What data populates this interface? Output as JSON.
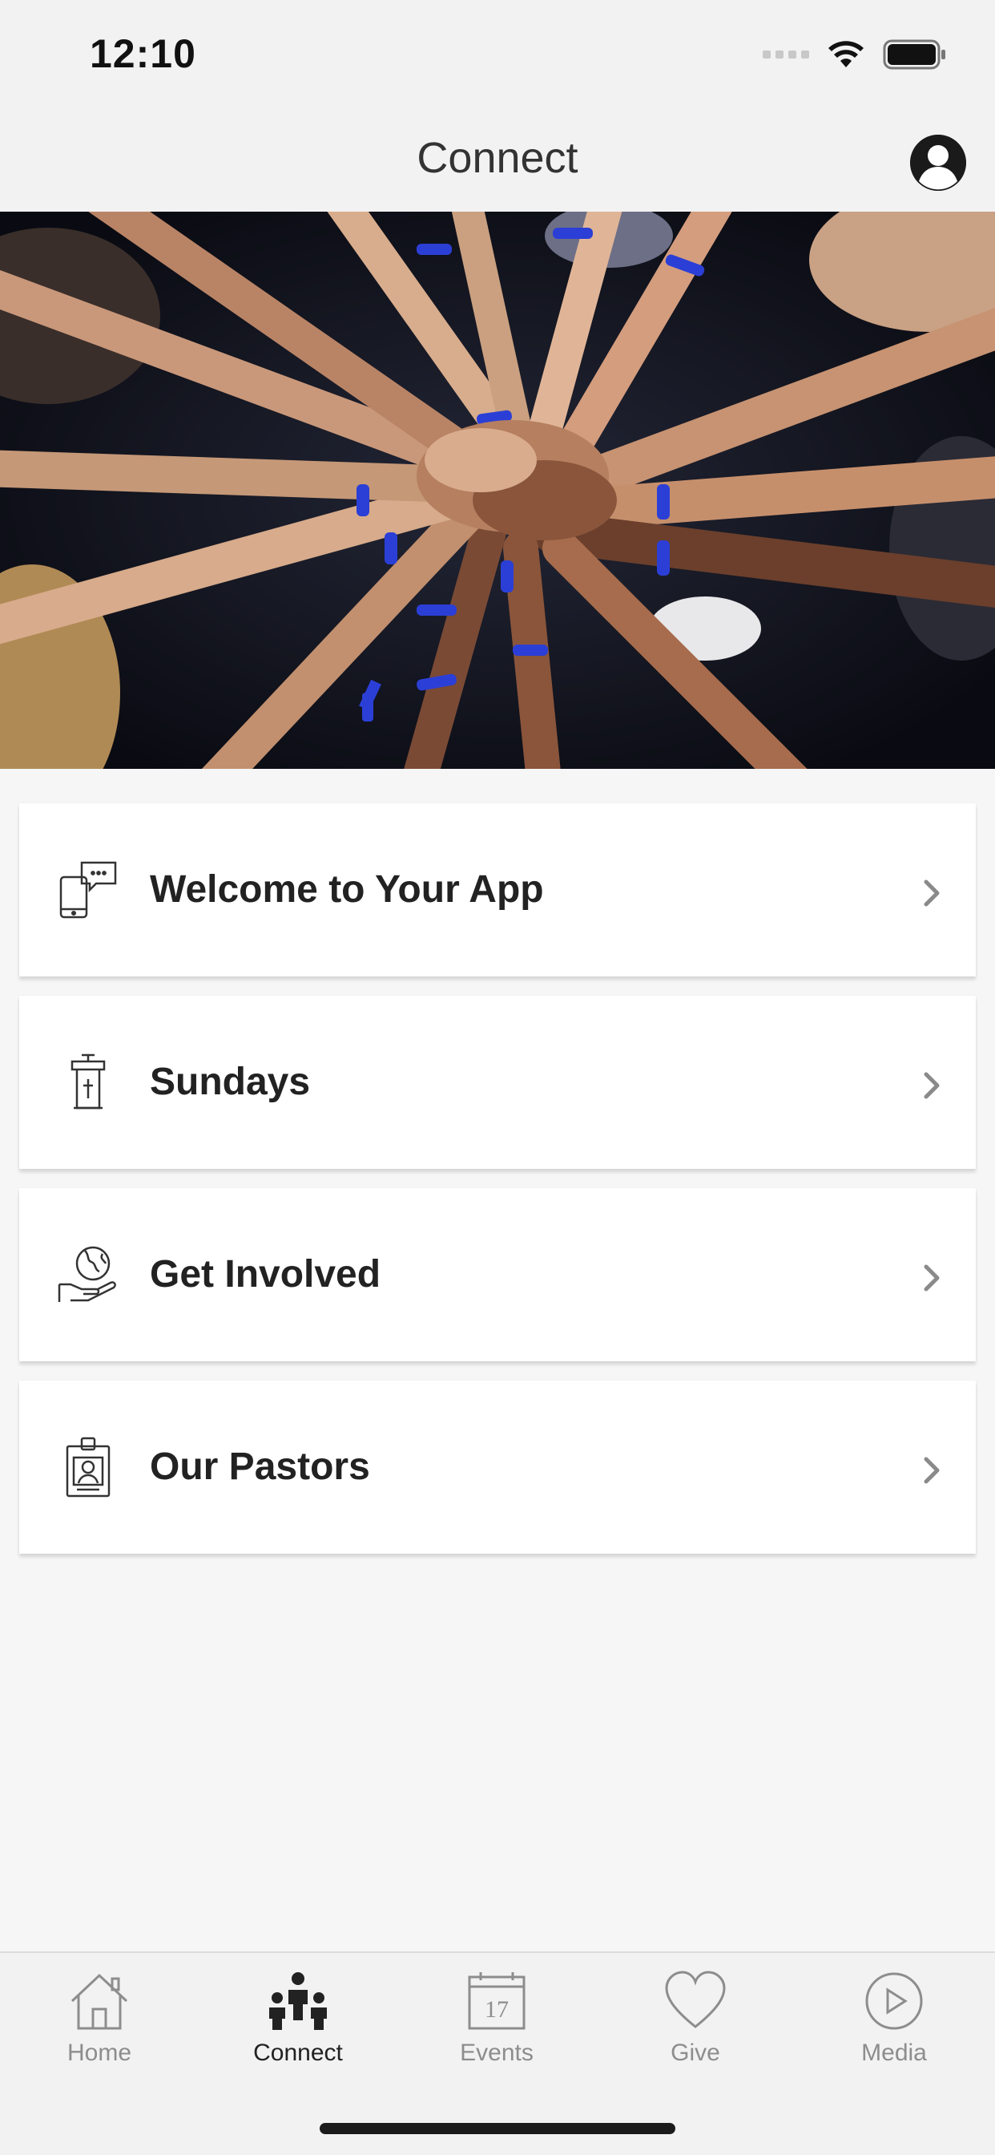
{
  "status_bar": {
    "time": "12:10"
  },
  "header": {
    "title": "Connect",
    "profile_icon": "user-circle-icon"
  },
  "hero": {
    "image_description_icon": "hands-together-photo"
  },
  "menu": [
    {
      "label": "Welcome to Your App",
      "icon": "phone-chat-icon"
    },
    {
      "label": "Sundays",
      "icon": "pulpit-icon"
    },
    {
      "label": "Get Involved",
      "icon": "hand-globe-icon"
    },
    {
      "label": "Our Pastors",
      "icon": "id-badge-icon"
    }
  ],
  "tabs": [
    {
      "label": "Home",
      "icon": "home-icon",
      "active": false
    },
    {
      "label": "Connect",
      "icon": "people-icon",
      "active": true
    },
    {
      "label": "Events",
      "icon": "calendar-icon",
      "active": false,
      "calendar_day": "17"
    },
    {
      "label": "Give",
      "icon": "heart-icon",
      "active": false
    },
    {
      "label": "Media",
      "icon": "play-circle-icon",
      "active": false
    }
  ],
  "colors": {
    "background": "#f6f6f6",
    "card": "#ffffff",
    "active_tab": "#222222",
    "inactive_tab": "#8d8d8d",
    "wristband_blue": "#2b3fd6"
  }
}
